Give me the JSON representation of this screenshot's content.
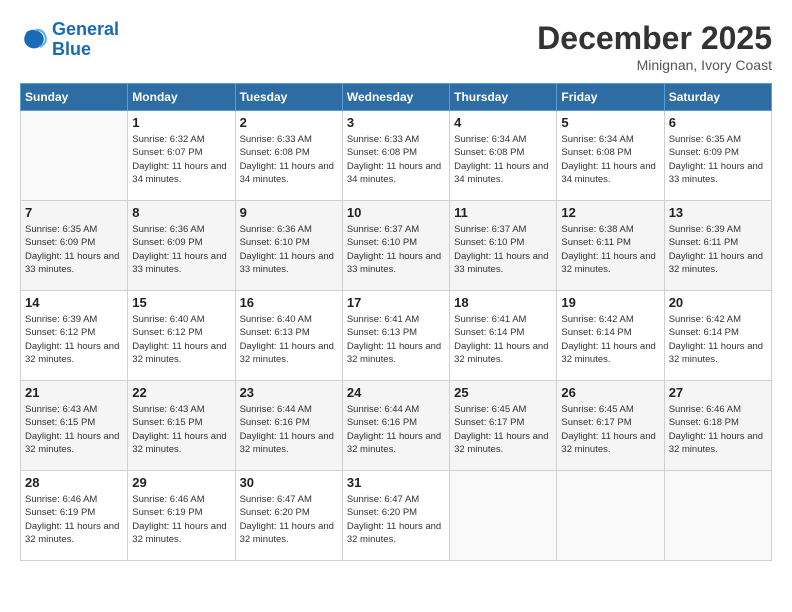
{
  "logo": {
    "text_general": "General",
    "text_blue": "Blue"
  },
  "title": "December 2025",
  "subtitle": "Minignan, Ivory Coast",
  "header_days": [
    "Sunday",
    "Monday",
    "Tuesday",
    "Wednesday",
    "Thursday",
    "Friday",
    "Saturday"
  ],
  "weeks": [
    [
      {
        "day": "",
        "sunrise": "",
        "sunset": "",
        "daylight": ""
      },
      {
        "day": "1",
        "sunrise": "Sunrise: 6:32 AM",
        "sunset": "Sunset: 6:07 PM",
        "daylight": "Daylight: 11 hours and 34 minutes."
      },
      {
        "day": "2",
        "sunrise": "Sunrise: 6:33 AM",
        "sunset": "Sunset: 6:08 PM",
        "daylight": "Daylight: 11 hours and 34 minutes."
      },
      {
        "day": "3",
        "sunrise": "Sunrise: 6:33 AM",
        "sunset": "Sunset: 6:08 PM",
        "daylight": "Daylight: 11 hours and 34 minutes."
      },
      {
        "day": "4",
        "sunrise": "Sunrise: 6:34 AM",
        "sunset": "Sunset: 6:08 PM",
        "daylight": "Daylight: 11 hours and 34 minutes."
      },
      {
        "day": "5",
        "sunrise": "Sunrise: 6:34 AM",
        "sunset": "Sunset: 6:08 PM",
        "daylight": "Daylight: 11 hours and 34 minutes."
      },
      {
        "day": "6",
        "sunrise": "Sunrise: 6:35 AM",
        "sunset": "Sunset: 6:09 PM",
        "daylight": "Daylight: 11 hours and 33 minutes."
      }
    ],
    [
      {
        "day": "7",
        "sunrise": "Sunrise: 6:35 AM",
        "sunset": "Sunset: 6:09 PM",
        "daylight": "Daylight: 11 hours and 33 minutes."
      },
      {
        "day": "8",
        "sunrise": "Sunrise: 6:36 AM",
        "sunset": "Sunset: 6:09 PM",
        "daylight": "Daylight: 11 hours and 33 minutes."
      },
      {
        "day": "9",
        "sunrise": "Sunrise: 6:36 AM",
        "sunset": "Sunset: 6:10 PM",
        "daylight": "Daylight: 11 hours and 33 minutes."
      },
      {
        "day": "10",
        "sunrise": "Sunrise: 6:37 AM",
        "sunset": "Sunset: 6:10 PM",
        "daylight": "Daylight: 11 hours and 33 minutes."
      },
      {
        "day": "11",
        "sunrise": "Sunrise: 6:37 AM",
        "sunset": "Sunset: 6:10 PM",
        "daylight": "Daylight: 11 hours and 33 minutes."
      },
      {
        "day": "12",
        "sunrise": "Sunrise: 6:38 AM",
        "sunset": "Sunset: 6:11 PM",
        "daylight": "Daylight: 11 hours and 32 minutes."
      },
      {
        "day": "13",
        "sunrise": "Sunrise: 6:39 AM",
        "sunset": "Sunset: 6:11 PM",
        "daylight": "Daylight: 11 hours and 32 minutes."
      }
    ],
    [
      {
        "day": "14",
        "sunrise": "Sunrise: 6:39 AM",
        "sunset": "Sunset: 6:12 PM",
        "daylight": "Daylight: 11 hours and 32 minutes."
      },
      {
        "day": "15",
        "sunrise": "Sunrise: 6:40 AM",
        "sunset": "Sunset: 6:12 PM",
        "daylight": "Daylight: 11 hours and 32 minutes."
      },
      {
        "day": "16",
        "sunrise": "Sunrise: 6:40 AM",
        "sunset": "Sunset: 6:13 PM",
        "daylight": "Daylight: 11 hours and 32 minutes."
      },
      {
        "day": "17",
        "sunrise": "Sunrise: 6:41 AM",
        "sunset": "Sunset: 6:13 PM",
        "daylight": "Daylight: 11 hours and 32 minutes."
      },
      {
        "day": "18",
        "sunrise": "Sunrise: 6:41 AM",
        "sunset": "Sunset: 6:14 PM",
        "daylight": "Daylight: 11 hours and 32 minutes."
      },
      {
        "day": "19",
        "sunrise": "Sunrise: 6:42 AM",
        "sunset": "Sunset: 6:14 PM",
        "daylight": "Daylight: 11 hours and 32 minutes."
      },
      {
        "day": "20",
        "sunrise": "Sunrise: 6:42 AM",
        "sunset": "Sunset: 6:14 PM",
        "daylight": "Daylight: 11 hours and 32 minutes."
      }
    ],
    [
      {
        "day": "21",
        "sunrise": "Sunrise: 6:43 AM",
        "sunset": "Sunset: 6:15 PM",
        "daylight": "Daylight: 11 hours and 32 minutes."
      },
      {
        "day": "22",
        "sunrise": "Sunrise: 6:43 AM",
        "sunset": "Sunset: 6:15 PM",
        "daylight": "Daylight: 11 hours and 32 minutes."
      },
      {
        "day": "23",
        "sunrise": "Sunrise: 6:44 AM",
        "sunset": "Sunset: 6:16 PM",
        "daylight": "Daylight: 11 hours and 32 minutes."
      },
      {
        "day": "24",
        "sunrise": "Sunrise: 6:44 AM",
        "sunset": "Sunset: 6:16 PM",
        "daylight": "Daylight: 11 hours and 32 minutes."
      },
      {
        "day": "25",
        "sunrise": "Sunrise: 6:45 AM",
        "sunset": "Sunset: 6:17 PM",
        "daylight": "Daylight: 11 hours and 32 minutes."
      },
      {
        "day": "26",
        "sunrise": "Sunrise: 6:45 AM",
        "sunset": "Sunset: 6:17 PM",
        "daylight": "Daylight: 11 hours and 32 minutes."
      },
      {
        "day": "27",
        "sunrise": "Sunrise: 6:46 AM",
        "sunset": "Sunset: 6:18 PM",
        "daylight": "Daylight: 11 hours and 32 minutes."
      }
    ],
    [
      {
        "day": "28",
        "sunrise": "Sunrise: 6:46 AM",
        "sunset": "Sunset: 6:19 PM",
        "daylight": "Daylight: 11 hours and 32 minutes."
      },
      {
        "day": "29",
        "sunrise": "Sunrise: 6:46 AM",
        "sunset": "Sunset: 6:19 PM",
        "daylight": "Daylight: 11 hours and 32 minutes."
      },
      {
        "day": "30",
        "sunrise": "Sunrise: 6:47 AM",
        "sunset": "Sunset: 6:20 PM",
        "daylight": "Daylight: 11 hours and 32 minutes."
      },
      {
        "day": "31",
        "sunrise": "Sunrise: 6:47 AM",
        "sunset": "Sunset: 6:20 PM",
        "daylight": "Daylight: 11 hours and 32 minutes."
      },
      {
        "day": "",
        "sunrise": "",
        "sunset": "",
        "daylight": ""
      },
      {
        "day": "",
        "sunrise": "",
        "sunset": "",
        "daylight": ""
      },
      {
        "day": "",
        "sunrise": "",
        "sunset": "",
        "daylight": ""
      }
    ]
  ]
}
